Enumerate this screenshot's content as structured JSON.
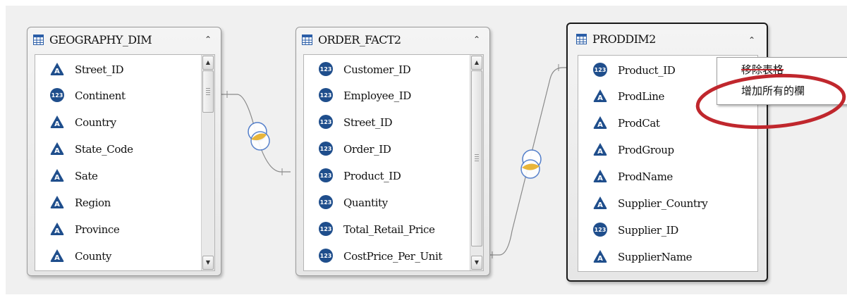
{
  "canvas": {
    "background": "#f0f0f0"
  },
  "tables": [
    {
      "title": "GEOGRAPHY_DIM",
      "collapse_icon": "chevron-up-icon",
      "columns": [
        {
          "name": "Street_ID",
          "type": "character"
        },
        {
          "name": "Continent",
          "type": "numeric"
        },
        {
          "name": "Country",
          "type": "character"
        },
        {
          "name": "State_Code",
          "type": "character"
        },
        {
          "name": "Sate",
          "type": "character"
        },
        {
          "name": "Region",
          "type": "character"
        },
        {
          "name": "Province",
          "type": "character"
        },
        {
          "name": "County",
          "type": "character"
        }
      ]
    },
    {
      "title": "ORDER_FACT2",
      "collapse_icon": "chevron-up-icon",
      "columns": [
        {
          "name": "Customer_ID",
          "type": "numeric"
        },
        {
          "name": "Employee_ID",
          "type": "numeric"
        },
        {
          "name": "Street_ID",
          "type": "numeric"
        },
        {
          "name": "Order_ID",
          "type": "numeric"
        },
        {
          "name": "Product_ID",
          "type": "numeric"
        },
        {
          "name": "Quantity",
          "type": "numeric"
        },
        {
          "name": "Total_Retail_Price",
          "type": "numeric"
        },
        {
          "name": "CostPrice_Per_Unit",
          "type": "numeric"
        }
      ]
    },
    {
      "title": "PRODDIM2",
      "selected": true,
      "collapse_icon": "chevron-up-icon",
      "columns": [
        {
          "name": "Product_ID",
          "type": "numeric"
        },
        {
          "name": "ProdLine",
          "type": "character"
        },
        {
          "name": "ProdCat",
          "type": "character"
        },
        {
          "name": "ProdGroup",
          "type": "character"
        },
        {
          "name": "ProdName",
          "type": "character"
        },
        {
          "name": "Supplier_Country",
          "type": "character"
        },
        {
          "name": "Supplier_ID",
          "type": "numeric"
        },
        {
          "name": "SupplierName",
          "type": "character"
        }
      ]
    }
  ],
  "icons": {
    "numeric_glyph": "123",
    "character_glyph": "A",
    "type_icon_color": "#1f4e8c"
  },
  "context_menu": {
    "items": [
      {
        "label": "移除表格",
        "struck": true
      },
      {
        "label": "增加所有的欄",
        "struck": false
      }
    ]
  },
  "colors": {
    "annotation_ellipse": "#c0272d",
    "join_icon_fill": "#e8b53a",
    "join_icon_outline": "#4a78c8",
    "selected_border": "#1a1a1a"
  }
}
